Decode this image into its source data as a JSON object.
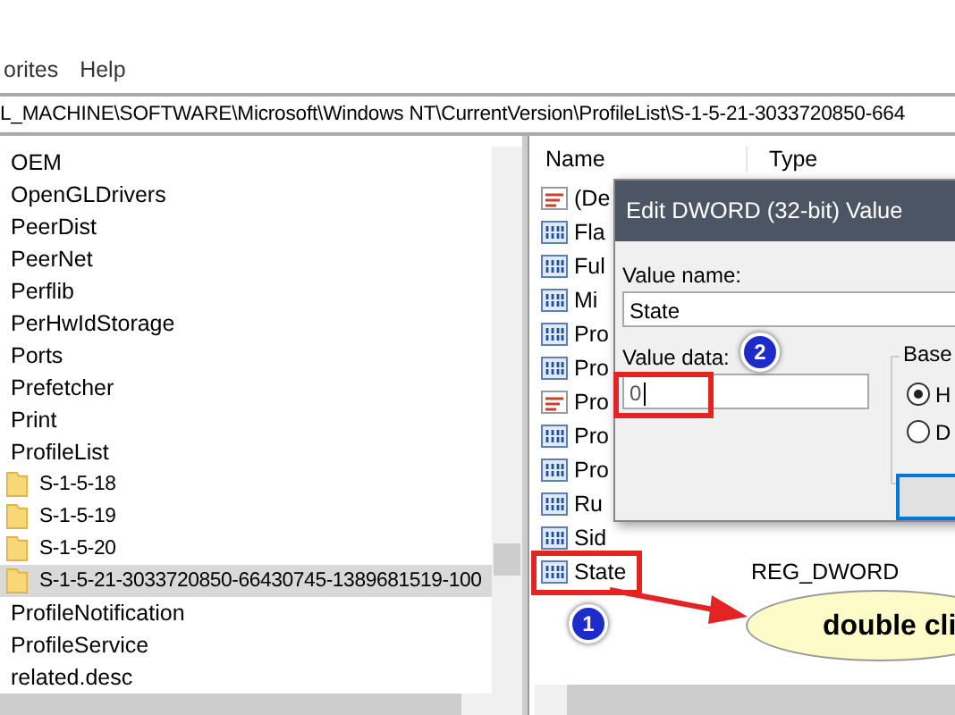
{
  "menu": [
    "orites",
    "Help"
  ],
  "address": "L_MACHINE\\SOFTWARE\\Microsoft\\Windows NT\\CurrentVersion\\ProfileList\\S-1-5-21-3033720850-664",
  "tree": [
    {
      "label": "OEM",
      "selected": false
    },
    {
      "label": "OpenGLDrivers",
      "selected": false
    },
    {
      "label": "PeerDist",
      "selected": false
    },
    {
      "label": "PeerNet",
      "selected": false
    },
    {
      "label": "Perflib",
      "selected": false
    },
    {
      "label": "PerHwIdStorage",
      "selected": false
    },
    {
      "label": "Ports",
      "selected": false
    },
    {
      "label": "Prefetcher",
      "selected": false
    },
    {
      "label": "Print",
      "selected": false
    },
    {
      "label": "ProfileList",
      "selected": false,
      "children": [
        {
          "label": "S-1-5-18",
          "selected": false
        },
        {
          "label": "S-1-5-19",
          "selected": false
        },
        {
          "label": "S-1-5-20",
          "selected": false
        },
        {
          "label": "S-1-5-21-3033720850-66430745-1389681519-100",
          "selected": true
        }
      ]
    },
    {
      "label": "ProfileNotification",
      "selected": false
    },
    {
      "label": "ProfileService",
      "selected": false
    },
    {
      "label": "related.desc",
      "selected": false
    }
  ],
  "values": {
    "columns": [
      "Name",
      "Type"
    ],
    "rows": [
      {
        "name": "(De",
        "kind": "string"
      },
      {
        "name": "Fla",
        "kind": "dword"
      },
      {
        "name": "Ful",
        "kind": "dword"
      },
      {
        "name": "Mi",
        "kind": "dword"
      },
      {
        "name": "Pro",
        "kind": "dword"
      },
      {
        "name": "Pro",
        "kind": "dword"
      },
      {
        "name": "Pro",
        "kind": "string"
      },
      {
        "name": "Pro",
        "kind": "dword"
      },
      {
        "name": "Pro",
        "kind": "dword"
      },
      {
        "name": "Ru",
        "kind": "dword"
      },
      {
        "name": "Sid",
        "kind": "dword"
      },
      {
        "name": "State",
        "kind": "dword",
        "type": "REG_DWORD"
      }
    ]
  },
  "dialog": {
    "title": "Edit DWORD (32-bit) Value",
    "value_name_label": "Value name:",
    "value_name": "State",
    "value_data_label": "Value data:",
    "value_data": "0",
    "base_label": "Base",
    "radios": [
      {
        "label": "H",
        "selected": true
      },
      {
        "label": "D",
        "selected": false
      }
    ]
  },
  "badges": [
    "1",
    "2"
  ],
  "callout": "double cli"
}
